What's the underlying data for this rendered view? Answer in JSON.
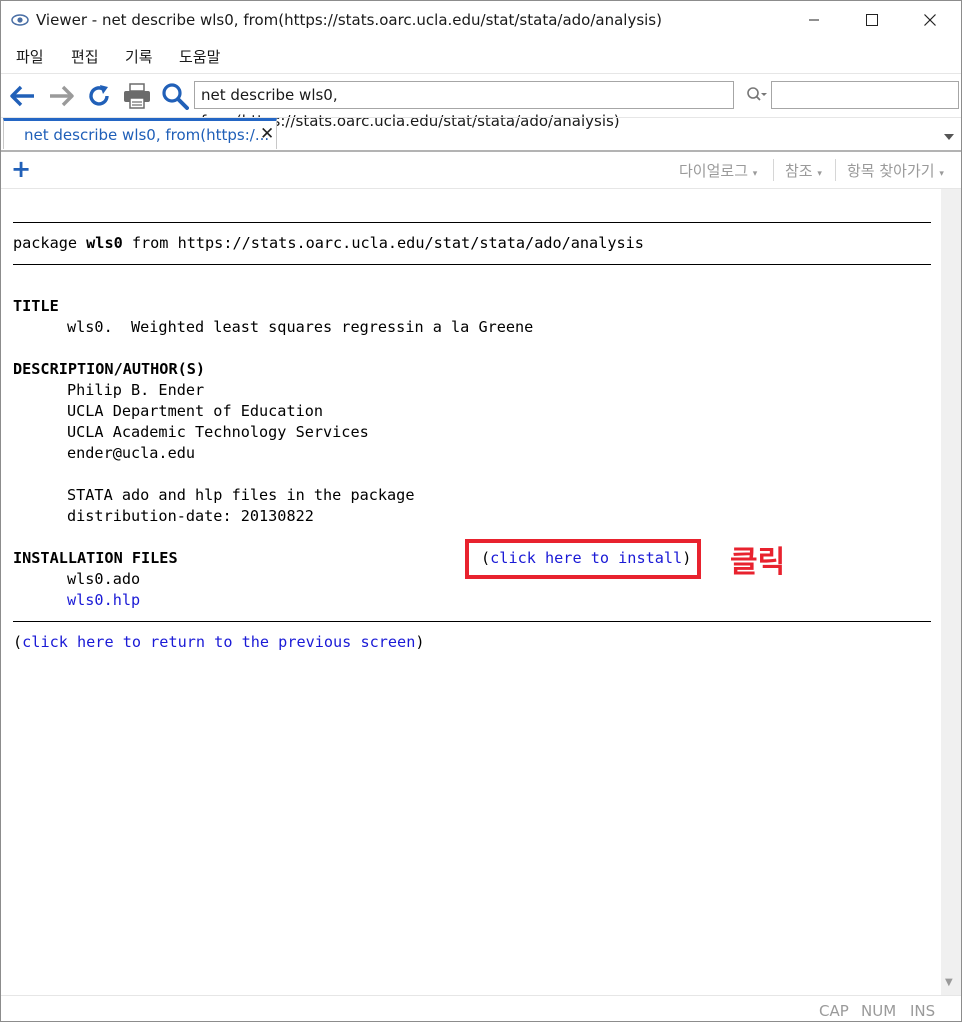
{
  "window": {
    "title": "Viewer - net describe wls0, from(https://stats.oarc.ucla.edu/stat/stata/ado/analysis)"
  },
  "menu": [
    "파일",
    "편집",
    "기록",
    "도움말"
  ],
  "toolbar": {
    "command_value": "net describe wls0, from(https://stats.oarc.ucla.edu/stat/stata/ado/analysis)",
    "find_value": "",
    "icons": [
      "back-arrow-icon",
      "forward-arrow-icon",
      "refresh-icon",
      "print-icon",
      "search-icon"
    ]
  },
  "tab": {
    "label": "net describe wls0, from(https:/...",
    "close": "✕"
  },
  "subbar": {
    "dialog": "다이얼로그",
    "refer": "참조",
    "jump": "항목 찾아가기"
  },
  "content": {
    "package_prefix": "package ",
    "package_name": "wls0",
    "package_from": " from https://stats.oarc.ucla.edu/stat/stata/ado/analysis",
    "title_heading": "TITLE",
    "title_text": "wls0.  Weighted least squares regressin a la Greene",
    "desc_heading": "DESCRIPTION/AUTHOR(S)",
    "desc_lines": [
      "Philip B. Ender",
      "UCLA Department of Education",
      "UCLA Academic Technology Services",
      "ender@ucla.edu",
      "",
      "STATA ado and hlp files in the package",
      "distribution-date: 20130822"
    ],
    "install_heading": "INSTALLATION FILES",
    "install_link_open": "(",
    "install_link": "click here to install",
    "install_link_close": ")",
    "files": [
      "wls0.ado",
      "wls0.hlp"
    ],
    "return_open": "(",
    "return_link": "click here to return to the previous screen",
    "return_close": ")"
  },
  "annotation": "클릭",
  "status": [
    "CAP",
    "NUM",
    "INS"
  ],
  "colors": {
    "link": "#1a1ad6",
    "accent": "#2466c4",
    "annotation": "#e8222e"
  }
}
